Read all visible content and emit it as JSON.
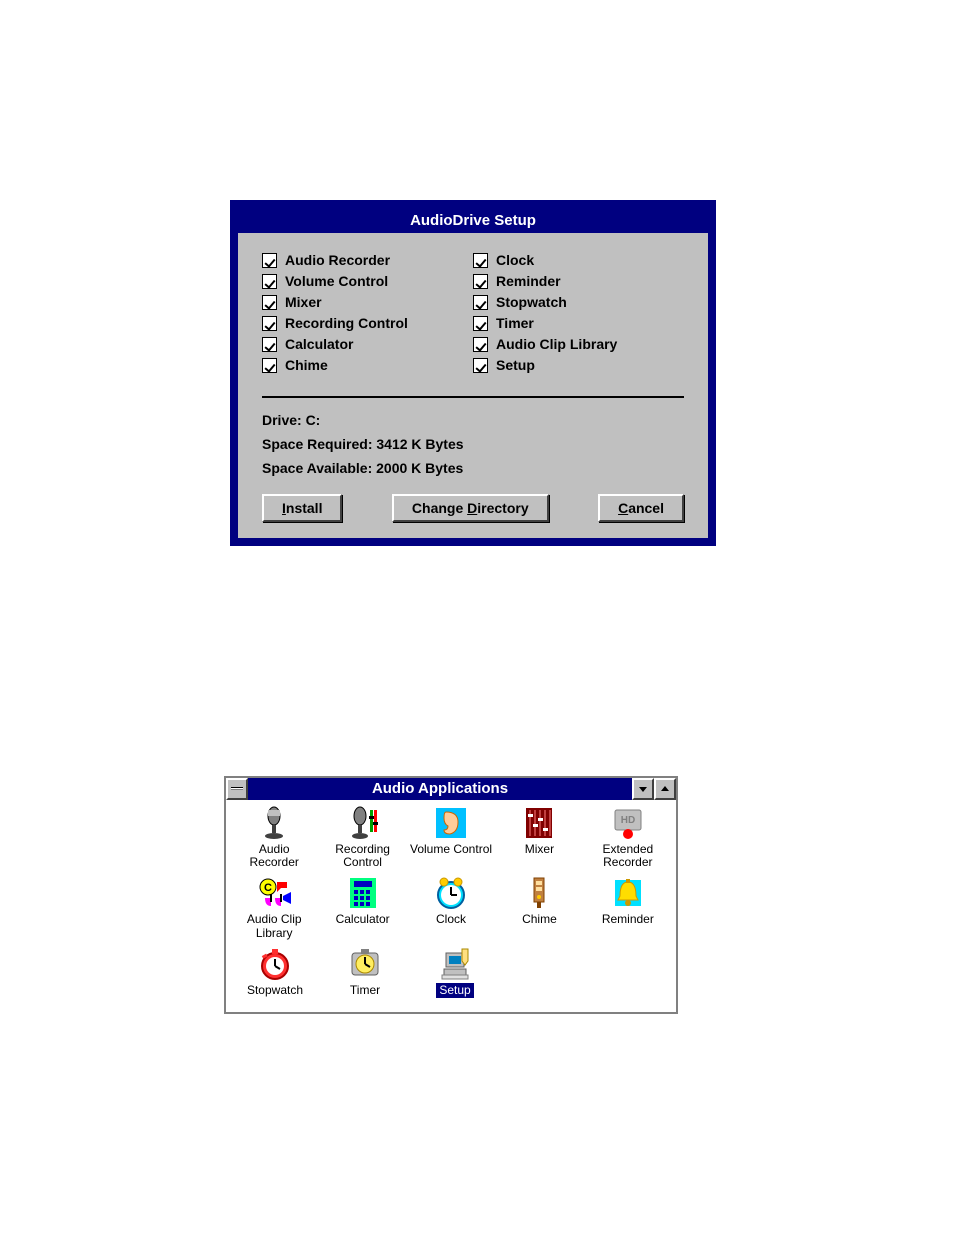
{
  "dialog": {
    "title": "AudioDrive Setup",
    "left_items": [
      {
        "label": "Audio Recorder",
        "checked": true
      },
      {
        "label": "Volume Control",
        "checked": true
      },
      {
        "label": "Mixer",
        "checked": true
      },
      {
        "label": "Recording Control",
        "checked": true
      },
      {
        "label": "Calculator",
        "checked": true
      },
      {
        "label": "Chime",
        "checked": true
      }
    ],
    "right_items": [
      {
        "label": "Clock",
        "checked": true
      },
      {
        "label": "Reminder",
        "checked": true
      },
      {
        "label": "Stopwatch",
        "checked": true
      },
      {
        "label": "Timer",
        "checked": true
      },
      {
        "label": "Audio Clip Library",
        "checked": true
      },
      {
        "label": "Setup",
        "checked": true
      }
    ],
    "drive_line": "Drive: C:",
    "space_required": "Space Required: 3412 K Bytes",
    "space_available": "Space Available: 2000 K Bytes",
    "buttons": {
      "install": "Install",
      "change_dir": "Change Directory",
      "cancel": "Cancel"
    }
  },
  "appwin": {
    "title": "Audio Applications",
    "icons": [
      {
        "label": "Audio Recorder",
        "icon": "microphone-icon",
        "selected": false
      },
      {
        "label": "Recording Control",
        "icon": "microphone-sliders-icon",
        "selected": false
      },
      {
        "label": "Volume Control",
        "icon": "ear-icon",
        "selected": false
      },
      {
        "label": "Mixer",
        "icon": "mixer-icon",
        "selected": false
      },
      {
        "label": "Extended Recorder",
        "icon": "hd-recorder-icon",
        "selected": false
      },
      {
        "label": "Audio Clip Library",
        "icon": "audio-clip-icon",
        "selected": false
      },
      {
        "label": "Calculator",
        "icon": "calculator-icon",
        "selected": false
      },
      {
        "label": "Clock",
        "icon": "clock-icon",
        "selected": false
      },
      {
        "label": "Chime",
        "icon": "chime-icon",
        "selected": false
      },
      {
        "label": "Reminder",
        "icon": "bell-icon",
        "selected": false
      },
      {
        "label": "Stopwatch",
        "icon": "stopwatch-icon",
        "selected": false
      },
      {
        "label": "Timer",
        "icon": "timer-icon",
        "selected": false
      },
      {
        "label": "Setup",
        "icon": "computer-setup-icon",
        "selected": true
      }
    ]
  }
}
